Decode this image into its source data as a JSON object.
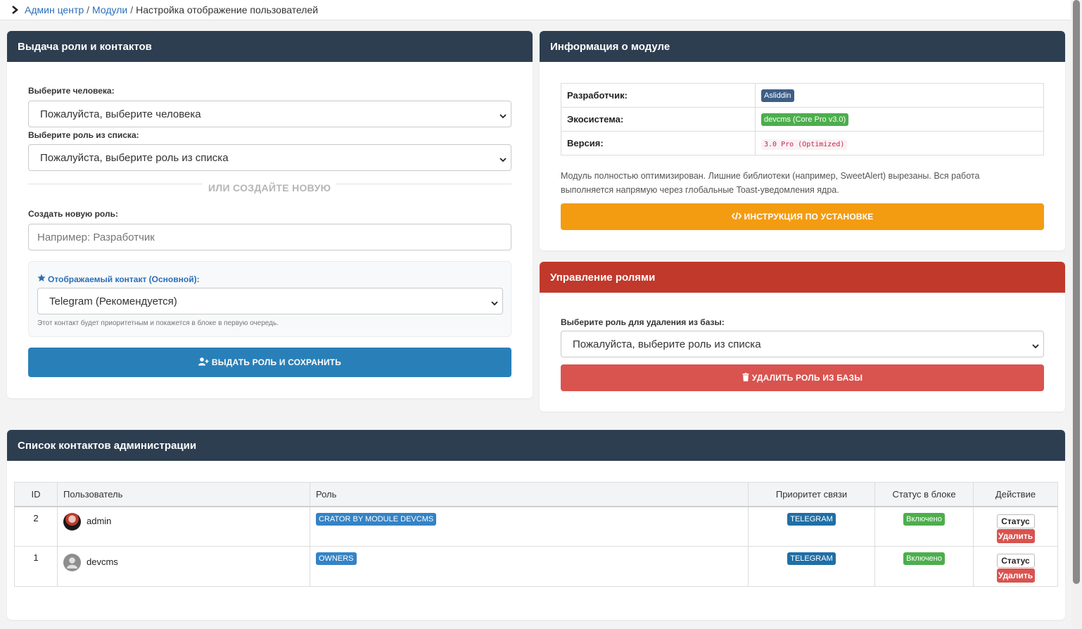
{
  "breadcrumb": {
    "items": [
      "Админ центр",
      "Модули"
    ],
    "current": "Настройка отображение пользователей",
    "separator": "/"
  },
  "assign_card": {
    "title": "Выдача роли и контактов",
    "person_label": "Выберите человека:",
    "person_value": "Пожалуйста, выберите человека",
    "role_label": "Выберите роль из списка:",
    "role_value": "Пожалуйста, выберите роль из списка",
    "or_text": "ИЛИ СОЗДАЙТЕ НОВУЮ",
    "new_role_label": "Создать новую роль:",
    "new_role_placeholder": "Например: Разработчик",
    "contact_label": "Отображаемый контакт (Основной):",
    "contact_value": "Telegram (Рекомендуется)",
    "contact_hint": "Этот контакт будет приоритетным и покажется в блоке в первую очередь.",
    "submit_label": "ВЫДАТЬ РОЛЬ И СОХРАНИТЬ"
  },
  "info_card": {
    "title": "Информация о модуле",
    "rows": [
      {
        "key": "Разработчик:",
        "value": "Asliddin"
      },
      {
        "key": "Экосистема:",
        "value": "devcms (Core Pro v3.0)"
      },
      {
        "key": "Версия:",
        "value": "3.0 Pro (Optimized)"
      }
    ],
    "description": "Модуль полностью оптимизирован. Лишние библиотеки (например, SweetAlert) вырезаны. Вся работа выполняется напрямую через глобальные Toast-уведомления ядра.",
    "install_button": "ИНСТРУКЦИЯ ПО УСТАНОВКЕ"
  },
  "roles_card": {
    "title": "Управление ролями",
    "delete_label": "Выберите роль для удаления из базы:",
    "delete_value": "Пожалуйста, выберите роль из списка",
    "delete_button": "УДАЛИТЬ РОЛЬ ИЗ БАЗЫ"
  },
  "list_card": {
    "title": "Список контактов администрации",
    "columns": [
      "ID",
      "Пользователь",
      "Роль",
      "Приоритет связи",
      "Статус в блоке",
      "Действие"
    ],
    "rows": [
      {
        "id": "2",
        "user": "admin",
        "role": "CRATOR BY MODULE DEVCMS",
        "priority": "TELEGRAM",
        "status": "Включено",
        "btn_status": "Статус",
        "btn_delete": "Удалить"
      },
      {
        "id": "1",
        "user": "devcms",
        "role": "OWNERS",
        "priority": "TELEGRAM",
        "status": "Включено",
        "btn_status": "Статус",
        "btn_delete": "Удалить"
      }
    ]
  },
  "colors": {
    "header_dark": "#2c3e50",
    "header_red": "#c0392b",
    "primary": "#2980b9",
    "warning": "#f39c12",
    "danger": "#d9534f",
    "success": "#4cae4c"
  }
}
